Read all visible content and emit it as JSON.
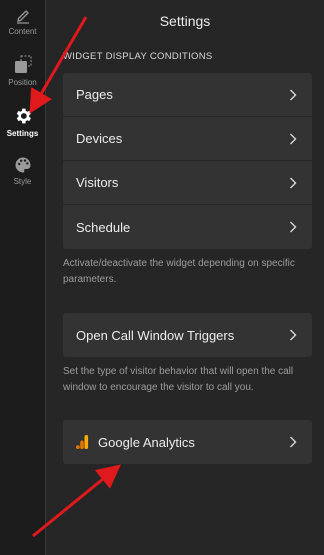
{
  "rail": {
    "items": [
      {
        "label": "Content",
        "icon": "pencil-icon"
      },
      {
        "label": "Position",
        "icon": "position-icon"
      },
      {
        "label": "Settings",
        "icon": "gear-icon"
      },
      {
        "label": "Style",
        "icon": "palette-icon"
      }
    ],
    "active": "Settings"
  },
  "panel": {
    "title": "Settings",
    "display_conditions": {
      "label": "WIDGET DISPLAY CONDITIONS",
      "items": [
        "Pages",
        "Devices",
        "Visitors",
        "Schedule"
      ],
      "hint": "Activate/deactivate the widget depending on specific parameters."
    },
    "triggers": {
      "label": "Open Call Window Triggers",
      "hint": "Set the type of visitor behavior that will open the call window to encourage the visitor to call you."
    },
    "analytics": {
      "label": "Google Analytics",
      "icon": "google-analytics-icon"
    }
  },
  "colors": {
    "background": "#262626",
    "rail": "#1c1c1c",
    "row": "#333333",
    "arrow": "#e0191c",
    "analytics_orange": "#f9ab00"
  }
}
